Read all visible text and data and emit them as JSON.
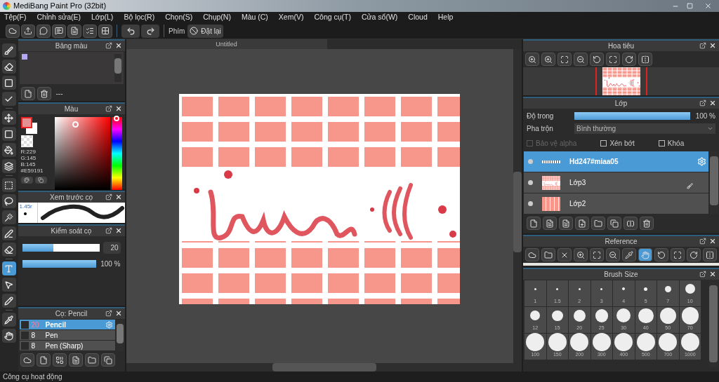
{
  "window": {
    "title": "MediBang Paint Pro (32bit)"
  },
  "menu": [
    "Tệp(F)",
    "Chỉnh sửa(E)",
    "Lớp(L)",
    "Bộ lọc(R)",
    "Chọn(S)",
    "Chụp(N)",
    "Màu (C)",
    "Xem(V)",
    "Công cụ(T)",
    "Cửa sổ(W)",
    "Cloud",
    "Help"
  ],
  "toolbar": {
    "shortcut_label": "Phím",
    "reset_button": "Đặt lại"
  },
  "tools": [
    {
      "kind": "brush",
      "selected": false
    },
    {
      "kind": "eraser",
      "selected": false
    },
    {
      "kind": "dot",
      "selected": false
    },
    {
      "kind": "line",
      "selected": false
    },
    {
      "kind": "move",
      "selected": false
    },
    {
      "kind": "fill",
      "selected": false
    },
    {
      "kind": "bucket",
      "selected": false
    },
    {
      "kind": "gradient",
      "selected": false
    },
    {
      "kind": "select",
      "selected": false
    },
    {
      "kind": "lasso",
      "selected": false
    },
    {
      "kind": "wand",
      "selected": false
    },
    {
      "kind": "selectpen",
      "selected": false
    },
    {
      "kind": "selecteraser",
      "selected": false
    },
    {
      "kind": "text",
      "selected": true
    },
    {
      "kind": "operation",
      "selected": false
    },
    {
      "kind": "divide",
      "selected": false
    },
    {
      "kind": "eyedropper",
      "selected": false
    },
    {
      "kind": "hand",
      "selected": false
    }
  ],
  "palette": {
    "title": "Bảng màu",
    "swatches": [
      {
        "color": "#b4a8f2"
      }
    ],
    "label": "---"
  },
  "color": {
    "title": "Màu",
    "r": "R:229",
    "g": "G:145",
    "b": "B:145",
    "hex": "#E59191"
  },
  "brush_preview": {
    "title": "Xem trước cọ",
    "size": "1.45r"
  },
  "brush_control": {
    "title": "Kiểm soát cọ",
    "size": {
      "level": 0.4,
      "reading": "20"
    },
    "opacity": {
      "level": 1,
      "reading": "100 %"
    }
  },
  "brushes": {
    "title": "Cọ: Pencil",
    "items": [
      {
        "size": "20",
        "name": "Pencil",
        "selected": true
      },
      {
        "size": "8",
        "name": "Pen",
        "selected": false
      },
      {
        "size": "8",
        "name": "Pen (Sharp)",
        "selected": false
      }
    ]
  },
  "document": {
    "tab": "Untitled"
  },
  "navigator": {
    "title": "Hoa tiêu"
  },
  "layers": {
    "title": "Lớp",
    "opacity_label": "Độ trong",
    "opacity": {
      "level": 1,
      "reading": "100 %"
    },
    "blend_label": "Pha trộn",
    "blend": "Bình thường",
    "options": [
      {
        "label": "Bảo vệ alpha",
        "checked": false,
        "disabled": true
      },
      {
        "label": "Xén bớt",
        "checked": false,
        "disabled": false
      },
      {
        "label": "Khóa",
        "checked": false,
        "disabled": false
      }
    ],
    "items": [
      {
        "name": "Hd247#miaa05",
        "selected": true,
        "kind": "text"
      },
      {
        "name": "Lớp3",
        "selected": false,
        "kind": "drawing"
      },
      {
        "name": "Lớp2",
        "selected": false,
        "kind": "tiles"
      }
    ]
  },
  "reference": {
    "title": "Reference"
  },
  "brush_size": {
    "title": "Brush Size",
    "sizes": [
      "1",
      "1.5",
      "2",
      "3",
      "4",
      "5",
      "7",
      "10",
      "12",
      "15",
      "20",
      "25",
      "30",
      "40",
      "50",
      "70",
      "100",
      "150",
      "200",
      "300",
      "400",
      "500",
      "700",
      "1000"
    ]
  },
  "status_bar": "Công cụ hoạt động"
}
